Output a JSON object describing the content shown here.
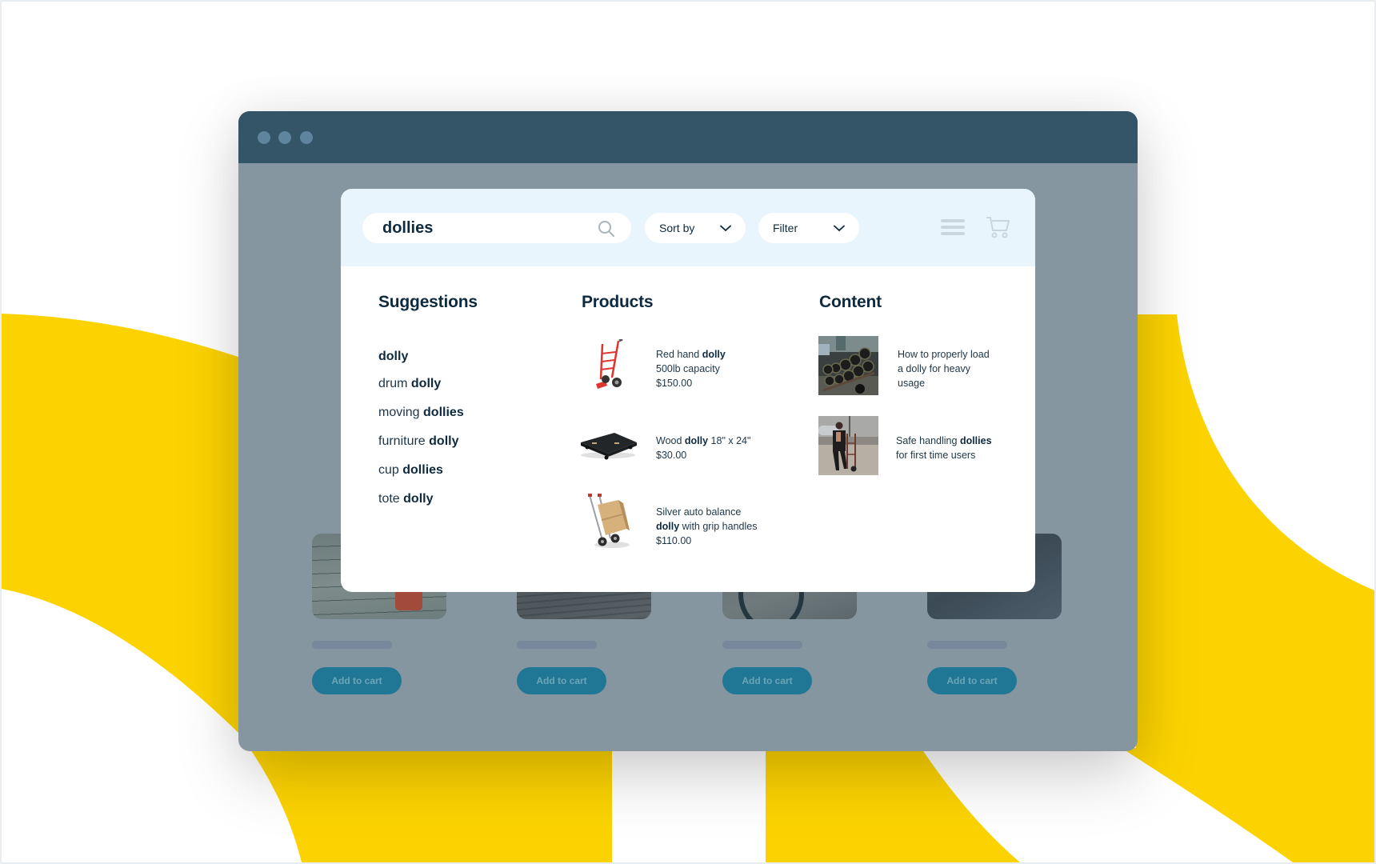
{
  "colors": {
    "yellow": "#fcd300",
    "window_titlebar": "#345467",
    "window_body": "#8596a1",
    "window_dot": "#5f849d",
    "modal_header": "#e8f5fd",
    "text_dark": "#0e2a3f",
    "add_to_cart": "#1f7795"
  },
  "window": {
    "dots": [
      "window-dot",
      "window-dot",
      "window-dot"
    ]
  },
  "search": {
    "query": "dollies",
    "icon": "search-icon"
  },
  "toolbar": {
    "sort_label": "Sort by",
    "filter_label": "Filter",
    "menu_icon": "hamburger-menu-icon",
    "cart_icon": "shopping-cart-icon"
  },
  "suggestions": {
    "title": "Suggestions",
    "items": [
      {
        "prefix": "",
        "match": "dolly"
      },
      {
        "prefix": "drum ",
        "match": "dolly"
      },
      {
        "prefix": "moving ",
        "match": "dollies"
      },
      {
        "prefix": "furniture ",
        "match": "dolly"
      },
      {
        "prefix": "cup ",
        "match": "dollies"
      },
      {
        "prefix": "tote ",
        "match": "dolly"
      }
    ]
  },
  "products": {
    "title": "Products",
    "items": [
      {
        "image": "red-hand-truck-image",
        "line1_prefix": "Red hand ",
        "line1_match": "dolly",
        "line1_suffix": "",
        "line2_prefix": "",
        "line2_match": "",
        "line2_suffix": "500lb capacity",
        "price": "$150.00"
      },
      {
        "image": "wood-platform-dolly-image",
        "line1_prefix": "Wood ",
        "line1_match": "dolly",
        "line1_suffix": " 18\" x 24\"",
        "price": "$30.00"
      },
      {
        "image": "silver-hand-truck-with-boxes-image",
        "line1_prefix": "Silver auto balance",
        "line1_match": "",
        "line1_suffix": "",
        "line2_prefix": "",
        "line2_match": "dolly",
        "line2_suffix": " with grip handles",
        "price": "$110.00"
      }
    ]
  },
  "content": {
    "title": "Content",
    "items": [
      {
        "image": "loaded-dolly-photo",
        "lines": [
          "How to properly load",
          "a dolly for heavy",
          "usage"
        ]
      },
      {
        "image": "man-with-hand-truck-photo",
        "line1_prefix": "Safe handling ",
        "line1_match": "dollies",
        "line2": "for first time users"
      }
    ]
  },
  "background_products": [
    {
      "button_label": "Add to cart"
    },
    {
      "button_label": "Add to cart"
    },
    {
      "button_label": "Add to cart"
    },
    {
      "button_label": "Add to cart"
    }
  ]
}
